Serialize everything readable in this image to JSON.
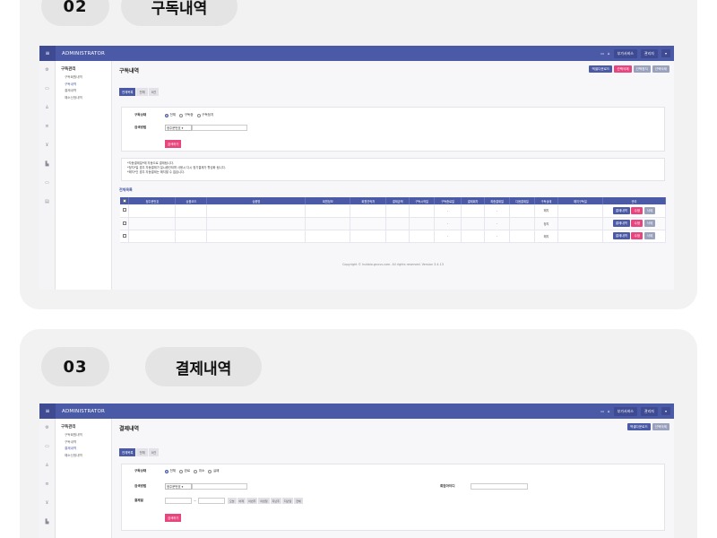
{
  "sections": [
    {
      "number": "02",
      "title": "구독내역",
      "app": {
        "brand": "ADMINISTRATOR",
        "topbar_links": [
          "부가서비스",
          "관리자"
        ],
        "submenu": {
          "head": "구독관리",
          "items": [
            "구독회원내역",
            "구독내역",
            "결제내역",
            "해소신청내역"
          ],
          "active_index": 1
        },
        "page_title": "구독내역",
        "header_buttons": [
          {
            "label": "엑셀다운로드",
            "color": "#4b5aa6"
          },
          {
            "label": "선택삭제",
            "color": "#e8457f"
          },
          {
            "label": "선택정지",
            "color": "#9aa1bd"
          },
          {
            "label": "선택삭제",
            "color": "#9aa1bd"
          }
        ],
        "tabs": [
          "전체목록",
          "전체",
          "0건"
        ],
        "filters": {
          "status_label": "구독상태",
          "status_options": [
            "전체",
            "구독중",
            "구독정지"
          ],
          "status_selected": 0,
          "method_label": "검색방법",
          "method_value": "정주문번호"
        },
        "search_button": "검색하기",
        "notes": [
          "*자동결제일*에 자동으로 결제됩니다.",
          "*정지*일 경우 자동결제가 일시중단되며 사용시 다시 정기결제가 활성화 됩니다.",
          "*해지*인 경우 자동결제는 해지할 수 없습니다."
        ],
        "list_title": "전체목록",
        "columns": [
          "",
          "정주문번호",
          "상품코드",
          "상품명",
          "회원정보",
          "회원연락처",
          "결제금액",
          "구독시작일",
          "구독종료일",
          "결제회차",
          "최종결제일",
          "다음결제일",
          "구독상태",
          "해지구독일",
          "관리"
        ],
        "rows": [
          {
            "date_a": "-",
            "date_b": "-",
            "status": "해지"
          },
          {
            "date_a": "-",
            "date_b": "-",
            "status": "정지"
          },
          {
            "date_a": "-",
            "date_b": "-",
            "status": "해지"
          }
        ],
        "row_actions": [
          "결제내역",
          "수정",
          "삭제"
        ],
        "footer": "Copyright © hubbio.gnuvs.com. All rights reserved. Version 3.4.13"
      }
    },
    {
      "number": "03",
      "title": "결제내역",
      "app": {
        "brand": "ADMINISTRATOR",
        "topbar_links": [
          "부가서비스",
          "관리자"
        ],
        "submenu": {
          "head": "구독관리",
          "items": [
            "구독회원내역",
            "구독내역",
            "결제내역",
            "해소신청내역"
          ],
          "active_index": 2
        },
        "page_title": "결제내역",
        "header_buttons": [
          {
            "label": "엑셀다운로드",
            "color": "#4b5aa6"
          },
          {
            "label": "선택삭제",
            "color": "#9aa1bd"
          }
        ],
        "tabs": [
          "전체목록",
          "전체",
          "0건"
        ],
        "filters": {
          "status_label": "구독상태",
          "status_options": [
            "전체",
            "완료",
            "취소",
            "실패"
          ],
          "status_selected": 0,
          "method_label": "검색방법",
          "method_value": "정주문번호",
          "member_label": "회원아이디",
          "date_label": "결제일",
          "date_sep": "~",
          "date_buttons": [
            "오늘",
            "어제",
            "이번주",
            "이번달",
            "지난주",
            "지난달",
            "전체"
          ]
        },
        "search_button": "검색하기"
      }
    }
  ]
}
